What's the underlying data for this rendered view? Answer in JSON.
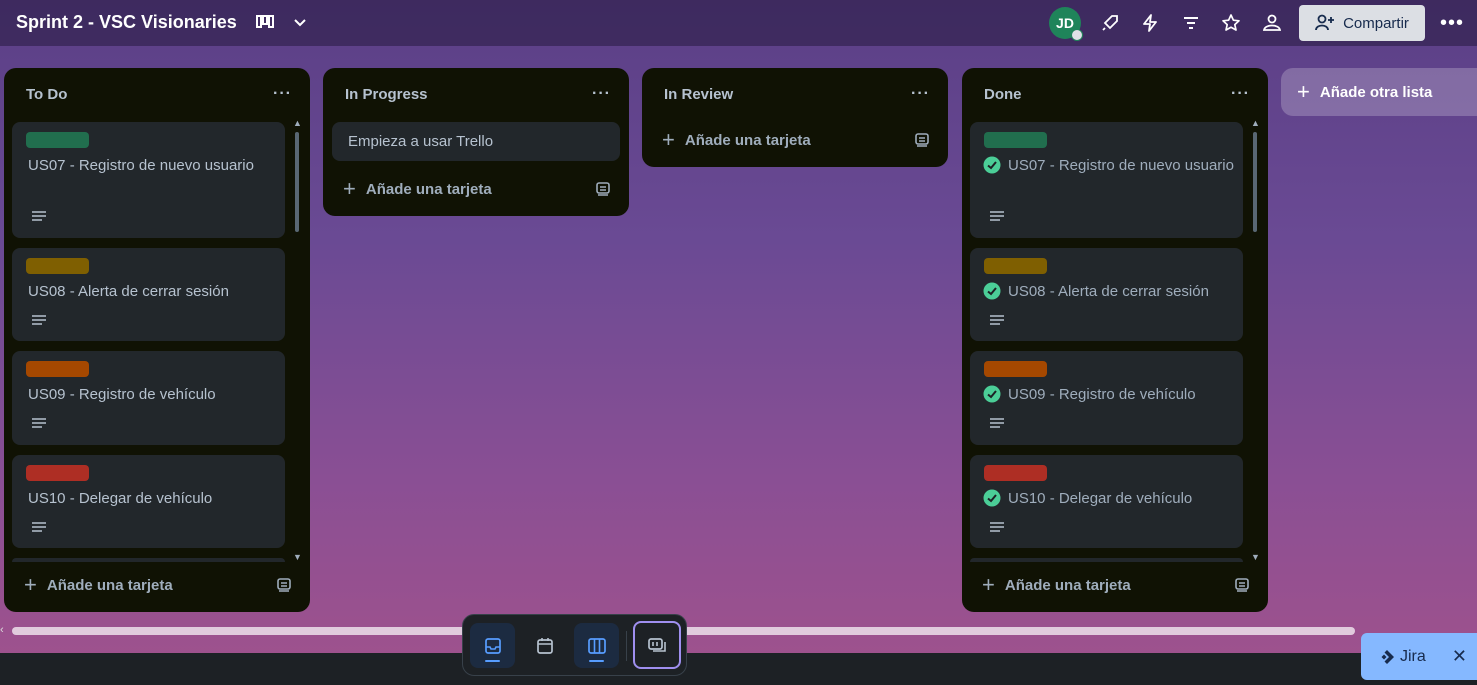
{
  "header": {
    "board_title": "Sprint 2 - VSC Visionaries",
    "avatar_initials": "JD",
    "share_label": "Compartir"
  },
  "lists": [
    {
      "title": "To Do",
      "cards": [
        {
          "title": "US07 - Registro de nuevo usuario",
          "label_color": "#216e4e"
        },
        {
          "title": "US08 - Alerta de cerrar sesión",
          "label_color": "#7f5f01"
        },
        {
          "title": "US09 - Registro de vehículo",
          "label_color": "#a54800"
        },
        {
          "title": "US10 - Delegar de vehículo",
          "label_color": "#ae2e24"
        }
      ],
      "add_card_label": "Añade una tarjeta"
    },
    {
      "title": "In Progress",
      "cards": [
        {
          "title": "Empieza a usar Trello"
        }
      ],
      "add_card_label": "Añade una tarjeta"
    },
    {
      "title": "In Review",
      "cards": [],
      "add_card_label": "Añade una tarjeta"
    },
    {
      "title": "Done",
      "cards": [
        {
          "title": "US07 - Registro de nuevo usuario",
          "label_color": "#216e4e"
        },
        {
          "title": "US08 - Alerta de cerrar sesión",
          "label_color": "#7f5f01"
        },
        {
          "title": "US09 - Registro de vehículo",
          "label_color": "#a54800"
        },
        {
          "title": "US10 - Delegar de vehículo",
          "label_color": "#ae2e24"
        }
      ],
      "add_card_label": "Añade una tarjeta"
    }
  ],
  "add_list_label": "Añade otra lista",
  "jira_label": "Jira",
  "icons": {
    "header": [
      "board-view-icon",
      "chevron-down-icon",
      "power-up-icon",
      "automation-icon",
      "filter-icon",
      "star-icon",
      "visibility-icon",
      "add-member-icon",
      "more-icon"
    ],
    "dock": [
      "inbox-icon",
      "calendar-icon",
      "board-icon",
      "switch-boards-icon"
    ],
    "card": [
      "description-icon",
      "check-circle-icon",
      "template-icon"
    ]
  },
  "colors": {
    "list_bg": "#101204",
    "card_bg": "#22272b",
    "check_green": "#4bce97"
  }
}
